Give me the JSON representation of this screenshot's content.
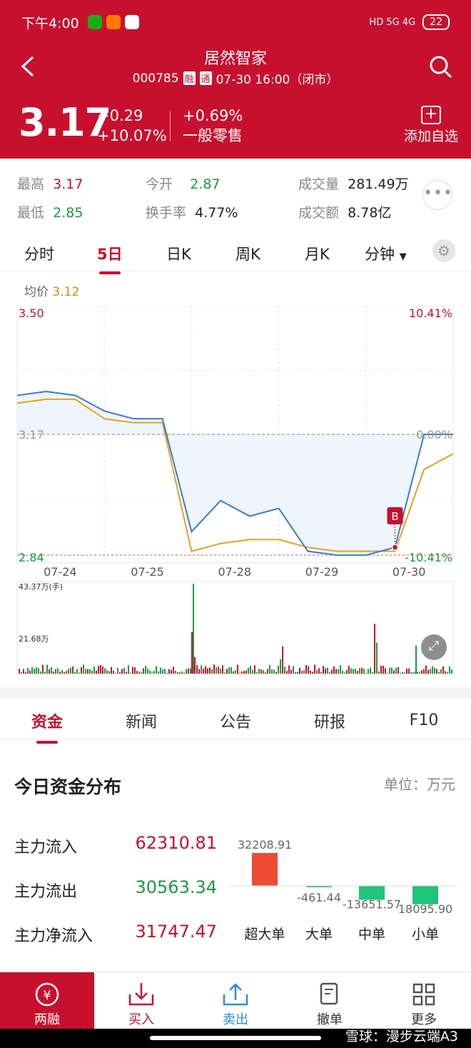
{
  "status_bar": {
    "time": "下午4:00",
    "battery": "22",
    "network": "HD 5G 4G"
  },
  "header": {
    "name": "居然智家",
    "code": "000785",
    "tag1": "融",
    "tag2": "通",
    "datetime": "07-30 16:00（闭市）",
    "price": "3.17",
    "change_abs": "+0.29",
    "change_pct": "+10.07%",
    "extra_pct": "+0.69%",
    "extra_label": "一般零售",
    "add_watch": "添加自选"
  },
  "stats": {
    "high_label": "最高",
    "high": "3.17",
    "low_label": "最低",
    "low": "2.85",
    "open_label": "今开",
    "open": "2.87",
    "turnover_label": "换手率",
    "turnover": "4.77%",
    "volume_label": "成交量",
    "volume": "281.49万",
    "amount_label": "成交额",
    "amount": "8.78亿"
  },
  "chart_tabs": [
    "分时",
    "5日",
    "日K",
    "周K",
    "月K",
    "分钟"
  ],
  "active_chart_tab": "5日",
  "avg": {
    "label": "均价",
    "value": "3.12"
  },
  "chart_data": [
    {
      "type": "line",
      "x": [
        "07-24",
        "07-25",
        "07-28",
        "07-29",
        "07-30"
      ],
      "series": [
        {
          "values": [
            3.27,
            3.28,
            3.27,
            3.23,
            3.21,
            3.21,
            2.92,
            3.0,
            2.96,
            2.98,
            2.87,
            2.86,
            2.86,
            2.88,
            3.17,
            3.17
          ]
        },
        {
          "values": [
            3.25,
            3.26,
            3.26,
            3.21,
            3.2,
            3.2,
            2.87,
            2.89,
            2.9,
            2.9,
            2.88,
            2.87,
            2.87,
            2.87,
            3.08,
            3.12
          ]
        }
      ],
      "ylim": [
        2.84,
        3.5
      ],
      "left_ticks": [
        "3.50",
        "3.17",
        "2.84"
      ],
      "right_ticks": [
        "10.41%",
        "0.00%",
        "-10.41%"
      ],
      "marker": "B",
      "colors": {
        "price": "#3a7bd5",
        "avg": "#e8a020",
        "prev_close": "#888888",
        "limit_down": "#d9534f"
      }
    },
    {
      "type": "bar",
      "y_ticks": [
        "43.37万(手)",
        "21.68万"
      ],
      "peaks": [
        43.37,
        8,
        7,
        24,
        15,
        40,
        22,
        14
      ]
    }
  ],
  "content_tabs": [
    "资金",
    "新闻",
    "公告",
    "研报",
    "F10"
  ],
  "active_content_tab": "资金",
  "fund": {
    "title": "今日资金分布",
    "unit": "单位：万元",
    "inflow_label": "主力流入",
    "inflow": "62310.81",
    "outflow_label": "主力流出",
    "outflow": "30563.34",
    "net_label": "主力净流入",
    "net": "31747.47",
    "bars": [
      {
        "label": "超大单",
        "value": "32208.91",
        "num": 32208.91
      },
      {
        "label": "大单",
        "value": "-461.44",
        "num": -461.44
      },
      {
        "label": "中单",
        "value": "-13651.57",
        "num": -13651.57
      },
      {
        "label": "小单",
        "value": "18095.90",
        "num": -18095.9
      }
    ]
  },
  "bottom_nav": [
    {
      "label": "两融",
      "icon": "yen-circle-icon"
    },
    {
      "label": "买入",
      "icon": "buy-icon"
    },
    {
      "label": "卖出",
      "icon": "sell-icon"
    },
    {
      "label": "撤单",
      "icon": "cancel-order-icon"
    },
    {
      "label": "更多",
      "icon": "more-grid-icon"
    }
  ],
  "watermark": "雪球：漫步云端A3"
}
